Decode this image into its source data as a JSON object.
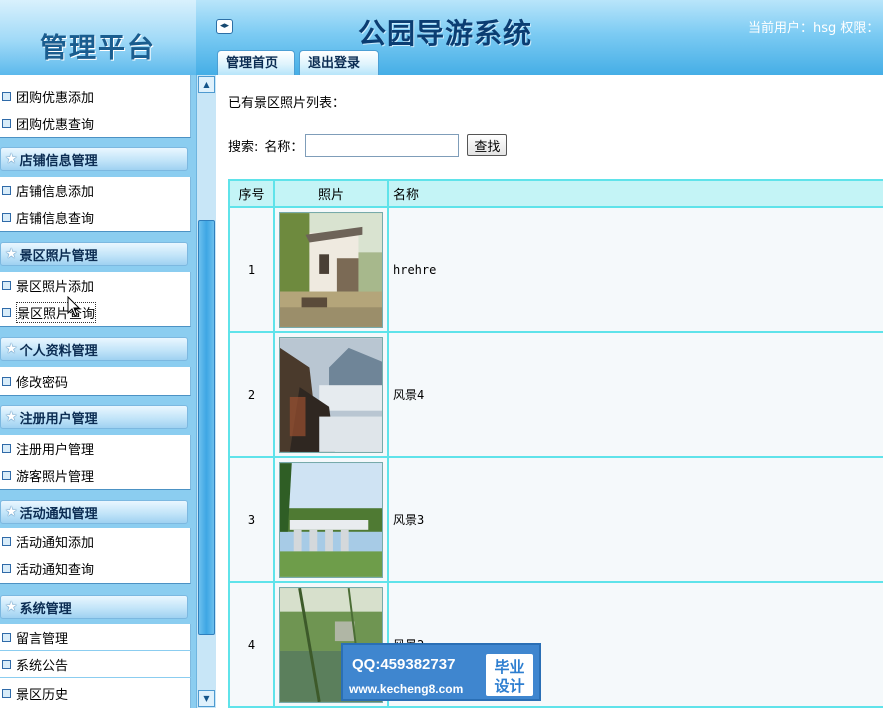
{
  "header": {
    "logo_text": "管理平台",
    "system_title": "公园导游系统",
    "user_info": "当前用户：hsg 权限：",
    "toggle_icon": "◂▸",
    "tabs": [
      {
        "label": "管理首页"
      },
      {
        "label": "退出登录"
      }
    ]
  },
  "sidebar": {
    "top_items": [
      {
        "label": "团购优惠添加"
      },
      {
        "label": "团购优惠查询"
      }
    ],
    "groups": [
      {
        "title": "店铺信息管理",
        "items": [
          {
            "label": "店铺信息添加"
          },
          {
            "label": "店铺信息查询"
          }
        ]
      },
      {
        "title": "景区照片管理",
        "items": [
          {
            "label": "景区照片添加"
          },
          {
            "label": "景区照片查询"
          }
        ]
      },
      {
        "title": "个人资料管理",
        "items": [
          {
            "label": "修改密码"
          }
        ]
      },
      {
        "title": "注册用户管理",
        "items": [
          {
            "label": "注册用户管理"
          },
          {
            "label": "游客照片管理"
          }
        ]
      },
      {
        "title": "活动通知管理",
        "items": [
          {
            "label": "活动通知添加"
          },
          {
            "label": "活动通知查询"
          }
        ]
      },
      {
        "title": "系统管理",
        "items": [
          {
            "label": "留言管理"
          },
          {
            "label": "系统公告"
          },
          {
            "label": "景区历史"
          }
        ]
      }
    ]
  },
  "main": {
    "list_title": "已有景区照片列表：",
    "search": {
      "label": "搜索:",
      "name_label": "名称：",
      "value": "",
      "placeholder": "",
      "button_label": "查找"
    },
    "table": {
      "headers": [
        "序号",
        "照片",
        "名称"
      ],
      "rows": [
        {
          "num": "1",
          "name": "hrehre",
          "photo": "building-photo"
        },
        {
          "num": "2",
          "name": "风景4",
          "photo": "mountain-mist-photo"
        },
        {
          "num": "3",
          "name": "风景3",
          "photo": "bridge-photo"
        },
        {
          "num": "4",
          "name": "风景2",
          "photo": "willow-pond-photo"
        }
      ]
    }
  },
  "watermark": {
    "qq": "QQ:459382737",
    "url": "www.kecheng8.com",
    "badge_line1": "毕业",
    "badge_line2": "设计"
  },
  "colors": {
    "header_blue": "#45aee6",
    "table_border": "#5fe3ea",
    "table_header_bg": "#c4f4f6",
    "sidebar_bg": "#8bcdf0"
  }
}
